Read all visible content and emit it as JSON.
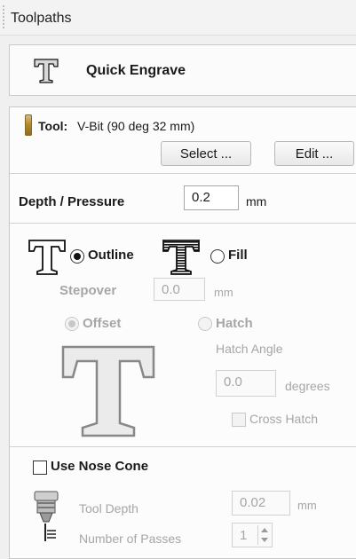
{
  "window": {
    "title": "Toolpaths"
  },
  "quick_engrave": {
    "label": "Quick Engrave",
    "icon": "text-t-icon"
  },
  "tool": {
    "label": "Tool:",
    "value": "V-Bit (90 deg 32 mm)",
    "select_label": "Select ...",
    "edit_label": "Edit ..."
  },
  "depth": {
    "label": "Depth / Pressure",
    "value": "0.2",
    "unit": "mm"
  },
  "mode": {
    "outline_label": "Outline",
    "fill_label": "Fill",
    "selected": "Outline"
  },
  "stepover": {
    "label": "Stepover",
    "value": "0.0",
    "unit": "mm"
  },
  "fill_style": {
    "offset_label": "Offset",
    "hatch_label": "Hatch",
    "selected": "Offset",
    "hatch_angle_label": "Hatch Angle",
    "hatch_angle_value": "0.0",
    "hatch_angle_unit": "degrees",
    "cross_hatch_label": "Cross Hatch",
    "cross_hatch_checked": false
  },
  "nose_cone": {
    "label": "Use Nose Cone",
    "checked": false,
    "tool_depth_label": "Tool Depth",
    "tool_depth_value": "0.02",
    "tool_depth_unit": "mm",
    "passes_label": "Number of Passes",
    "passes_value": "1"
  }
}
